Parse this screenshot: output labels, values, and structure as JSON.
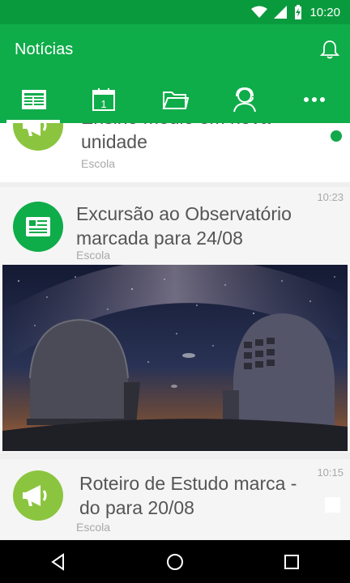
{
  "status_bar": {
    "time": "10:20"
  },
  "app_bar": {
    "title": "Notícias"
  },
  "tabs": [
    {
      "icon": "newspaper-icon"
    },
    {
      "icon": "calendar-icon",
      "day": "1"
    },
    {
      "icon": "folder-icon"
    },
    {
      "icon": "support-agent-icon"
    },
    {
      "icon": "more-icon"
    }
  ],
  "feed": {
    "items": [
      {
        "title": "Ensino médio em nova unidade",
        "source": "Escola",
        "time": "",
        "unread": true
      },
      {
        "title": "Excursão ao Observatório marcada para 24/08",
        "source": "Escola",
        "time": "10:23",
        "image": "observatory-night-sky"
      },
      {
        "title": "Roteiro de Estudo marca -do para 20/08",
        "source": "Escola",
        "time": "10:15"
      }
    ]
  },
  "colors": {
    "primary": "#0fac4a",
    "status_bar": "#0a9a3e",
    "avatar_green": "#8bc53f",
    "unread_dot": "#12a84b"
  }
}
